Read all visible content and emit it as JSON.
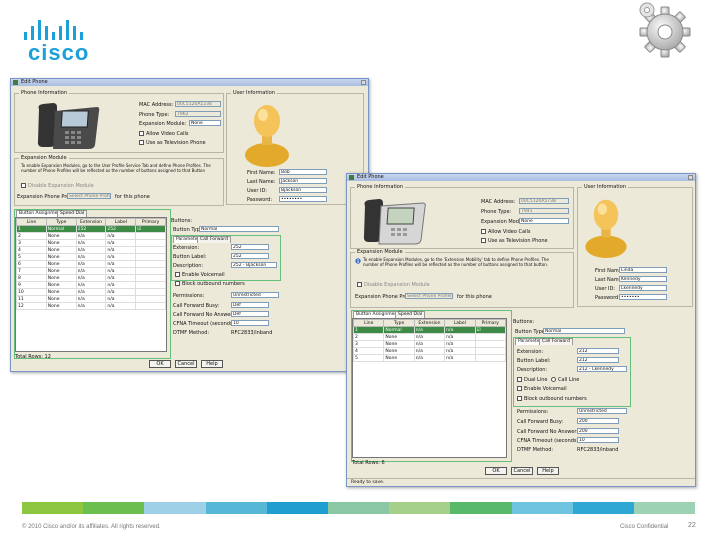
{
  "slide": {
    "footer_copyright": "© 2010 Cisco and/or its affiliates. All rights reserved.",
    "footer_confidential": "Cisco Confidential",
    "page_number": "22",
    "brand_color": "#1ba0d7",
    "footer_colors": [
      "#8dc63f",
      "#6bbf4e",
      "#9ed0e8",
      "#56b7d6",
      "#1f9fcf",
      "#8ac7a3",
      "#a4d089",
      "#58b96a",
      "#6fc4e0",
      "#2fa7d4",
      "#9dd3b4"
    ]
  },
  "logo": {
    "text": "cisco",
    "icon": "cisco-bridge-logo"
  },
  "gear": {
    "icon": "gear-icon"
  },
  "win1": {
    "title": "Edit Phone",
    "phone_info_title": "Phone Information",
    "user_info_title": "User Information",
    "mac_label": "MAC Address:",
    "mac_value": "00C5120A1234",
    "phone_type_label": "Phone Type:",
    "phone_type_value": "7962",
    "exp_module_label": "Expansion Module:",
    "exp_module_value": "None",
    "allow_video_label": "Allow Video Calls",
    "tv_label": "Use as Television Phone",
    "ext_module_title": "Expansion Module",
    "ext_module_text": "To enable Expansion Modules, go to the User Profile Service Tab and define Phone Profiles. The number of Phone Profiles will be reflected as the number of buttons assigned to that Button",
    "ext_disable_label": "Disable Expansion Module",
    "exp_phone_profile_label": "Expansion Phone Profile:",
    "exp_phone_profile_value": "Select Phone Profile",
    "exp_buttons_label": "for this phone",
    "first_name_label": "First Name:",
    "first_name_value": "Bob",
    "last_name_label": "Last Name:",
    "last_name_value": "Jackson",
    "user_id_label": "User ID:",
    "user_id_value": "Bjackson",
    "password_label": "Password:",
    "password_value": "••••••••",
    "tab_buttons": "Button Assignments",
    "tab_speed": "Speed Dial",
    "table_headers": [
      "Line",
      "Type",
      "Extension",
      "Label",
      "Primary"
    ],
    "rows": [
      [
        "1",
        "Normal",
        "252",
        "252",
        "☑"
      ],
      [
        "2",
        "None",
        "n/a",
        "n/a",
        ""
      ],
      [
        "3",
        "None",
        "n/a",
        "n/a",
        ""
      ],
      [
        "4",
        "None",
        "n/a",
        "n/a",
        ""
      ],
      [
        "5",
        "None",
        "n/a",
        "n/a",
        ""
      ],
      [
        "6",
        "None",
        "n/a",
        "n/a",
        ""
      ],
      [
        "7",
        "None",
        "n/a",
        "n/a",
        ""
      ],
      [
        "8",
        "None",
        "n/a",
        "n/a",
        ""
      ],
      [
        "9",
        "None",
        "n/a",
        "n/a",
        ""
      ],
      [
        "10",
        "None",
        "n/a",
        "n/a",
        ""
      ],
      [
        "11",
        "None",
        "n/a",
        "n/a",
        ""
      ],
      [
        "12",
        "None",
        "n/a",
        "n/a",
        ""
      ]
    ],
    "buttons_label": "Buttons:",
    "button_type_label": "Button Type:",
    "button_type_value": "Normal",
    "sub_tab_params": "Parameters",
    "sub_tab_forward": "Call Forward",
    "extension_label": "Extension:",
    "extension_value": "252",
    "button_label_label": "Button Label:",
    "button_label_value": "252",
    "description_label": "Description:",
    "description_value": "252 - Bjackson",
    "enable_voicemail": "Enable Voicemail",
    "block_outbound": "Block outbound numbers",
    "permissions_label": "Permissions:",
    "permissions_value": "Unrestricted",
    "cf_busy_label": "Call Forward Busy:",
    "cf_busy_value": "Def",
    "cf_noanswer_label": "Call Forward No Answer:",
    "cf_noanswer_value": "Def",
    "cfna_timeout_label": "CFNA Timeout (seconds):",
    "cfna_timeout_value": "10",
    "dtmf_label": "DTMF Method:",
    "dtmf_value": "RFC2833/inband",
    "total_rows": "Total Rows: 12",
    "ok": "OK",
    "cancel": "Cancel",
    "help": "Help"
  },
  "win2": {
    "title": "Edit Phone",
    "phone_info_title": "Phone Information",
    "user_info_title": "User Information",
    "mac_label": "MAC Address:",
    "mac_value": "00C5120A5738",
    "phone_type_label": "Phone Type:",
    "phone_type_value": "7941",
    "exp_module_label": "Expansion Module:",
    "exp_module_value": "None",
    "allow_video_label": "Allow Video Calls",
    "tv_label": "Use as Television Phone",
    "ext_module_title": "Expansion Module",
    "ext_module_text": "To enable Expansion Modules, go to the 'Extension Mobility' tab to define Phone Profiles. The number of Phone Profiles will be reflected as the number of buttons assigned to that button.",
    "ext_disable_label": "Disable Expansion Module",
    "exp_phone_profile_label": "Expansion Phone Profile:",
    "exp_phone_profile_value": "Select Phone Profile",
    "exp_buttons_label": "for this phone",
    "first_name_label": "First Name:",
    "first_name_value": "Linda",
    "last_name_label": "Last Name:",
    "last_name_value": "Kennedy",
    "user_id_label": "User ID:",
    "user_id_value": "Lkennedy",
    "password_label": "Password:",
    "password_value": "•••••••",
    "tab_buttons": "Button Assignments",
    "tab_speed": "Speed Dial",
    "table_headers": [
      "Line",
      "Type",
      "Extension",
      "Label",
      "Primary"
    ],
    "rows": [
      [
        "1",
        "Normal",
        "n/a",
        "n/a",
        "☑"
      ],
      [
        "2",
        "None",
        "n/a",
        "n/a",
        ""
      ],
      [
        "3",
        "None",
        "n/a",
        "n/a",
        ""
      ],
      [
        "4",
        "None",
        "n/a",
        "n/a",
        ""
      ],
      [
        "5",
        "None",
        "n/a",
        "n/a",
        ""
      ]
    ],
    "buttons_label": "Buttons:",
    "button_type_label": "Button Type:",
    "button_type_value": "Normal",
    "sub_tab_params": "Parameters",
    "sub_tab_forward": "Call Forward",
    "extension_label": "Extension:",
    "extension_value": "212",
    "button_label_label": "Button Label:",
    "button_label_value": "212",
    "description_label": "Description:",
    "description_value": "212 - Lkennedy",
    "dual_line": "Dual Line",
    "call_line": "Call Line",
    "enable_voicemail": "Enable Voicemail",
    "block_outbound": "Block outbound numbers",
    "permissions_label": "Permissions:",
    "permissions_value": "Unrestricted",
    "cf_busy_label": "Call Forward Busy:",
    "cf_busy_value": "200",
    "cf_noanswer_label": "Call Forward No Answer:",
    "cf_noanswer_value": "200",
    "cfna_timeout_label": "CFNA Timeout (seconds):",
    "cfna_timeout_value": "10",
    "dtmf_label": "DTMF Method:",
    "dtmf_value": "RFC2833/inband",
    "total_rows": "Total Rows: 6",
    "ok": "OK",
    "cancel": "Cancel",
    "help": "Help",
    "status": "Ready to save."
  }
}
